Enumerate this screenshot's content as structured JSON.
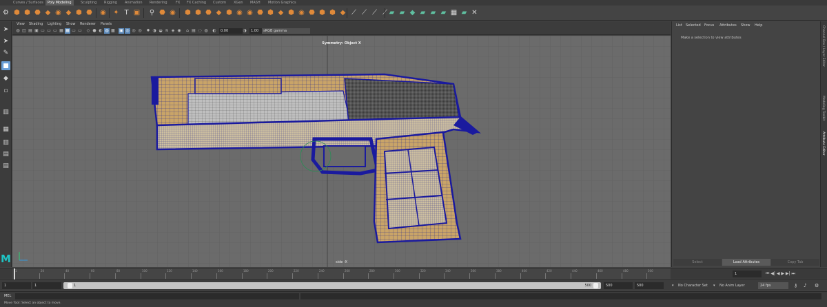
{
  "shelf": {
    "tabs": [
      "Curves / Surfaces",
      "Poly Modeling",
      "Sculpting",
      "Rigging",
      "Animation",
      "Rendering",
      "FX",
      "FX Caching",
      "Custom",
      "XGen",
      "MASH",
      "Motion Graphics"
    ],
    "active_tab": "Poly Modeling"
  },
  "panel": {
    "menu": [
      "View",
      "Shading",
      "Lighting",
      "Show",
      "Renderer",
      "Panels"
    ],
    "exposure": "0.00",
    "gamma": "1.00",
    "colorspace": "sRGB gamma",
    "symmetry_label": "Symmetry: Object X",
    "camera_label": "side -X"
  },
  "attribute_editor": {
    "menu": [
      "List",
      "Selected",
      "Focus",
      "Attributes",
      "Show",
      "Help"
    ],
    "message": "Make a selection to view attributes",
    "buttons": [
      "Select",
      "Load Attributes",
      "Copy Tab"
    ],
    "side_tabs": [
      "Channel Box / Layer Editor",
      "Modeling Toolkit",
      "Attribute Editor"
    ]
  },
  "timeline": {
    "current_frame": "1",
    "ticks": [
      "1",
      "20",
      "40",
      "60",
      "80",
      "100",
      "120",
      "140",
      "160",
      "180",
      "200",
      "220",
      "240",
      "260",
      "280",
      "300",
      "320",
      "340",
      "360",
      "380",
      "400",
      "420",
      "440",
      "460",
      "480",
      "500"
    ]
  },
  "range": {
    "start": "1",
    "playback_start": "1",
    "slider_start": "1",
    "slider_end": "500",
    "playback_end": "500",
    "end": "500",
    "character_set": "No Character Set",
    "anim_layer": "No Anim Layer",
    "fps": "24 fps"
  },
  "command": {
    "label": "MEL",
    "help": "Move Tool: Select an object to move."
  },
  "colors": {
    "viewport_bg": "#6b6b6b",
    "wire": "#1a1a9e",
    "surface": "#c9a468",
    "accent": "#e08a3a"
  }
}
